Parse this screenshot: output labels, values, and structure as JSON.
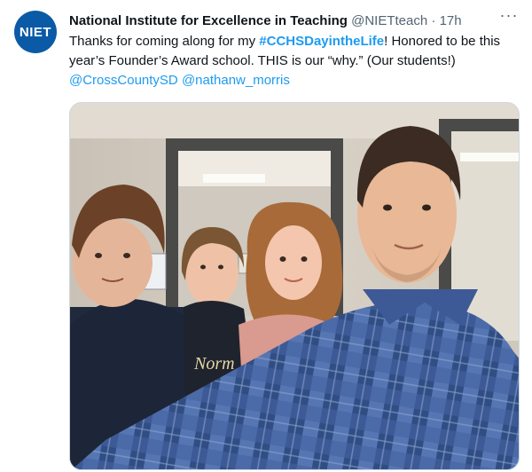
{
  "tweet": {
    "avatar_text": "NIET",
    "author_name": "National Institute for Excellence in Teaching",
    "author_handle": "@NIETteach",
    "separator": "·",
    "timestamp": "17h",
    "more_icon": "more-horizontal-icon",
    "text_before_hashtag": "Thanks for coming along for my ",
    "hashtag": "#CCHSDayintheLife",
    "text_after_hashtag": "! Honored to be this year’s Founder’s Award school. THIS is our “why.” (Our students!)",
    "mention_1": "@CrossCountySD",
    "mention_2": "@nathanw_morris",
    "photo_shirt_text": "Norm",
    "colors": {
      "link": "#1d9bf0",
      "avatar_bg": "#0a5aa6",
      "secondary_text": "#536471"
    }
  }
}
